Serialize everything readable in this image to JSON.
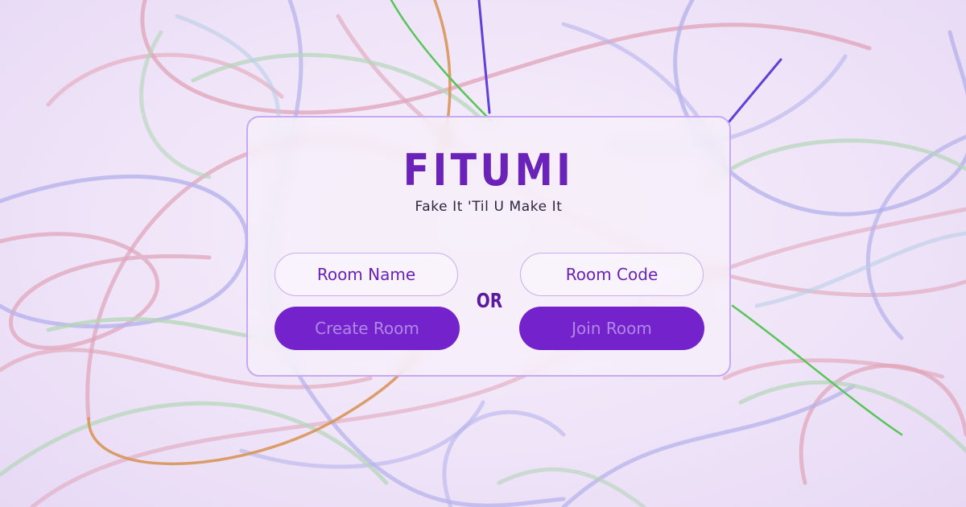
{
  "app": {
    "title": "FITUMI",
    "subtitle": "Fake It 'Til U Make It"
  },
  "create": {
    "room_name_placeholder": "Room Name",
    "button_label": "Create Room"
  },
  "join": {
    "room_code_placeholder": "Room Code",
    "button_label": "Join Room"
  },
  "separator": "OR",
  "colors": {
    "accent": "#7423cc",
    "title": "#6a22b8",
    "button_text": "#b088e6",
    "border": "#c6a9f1"
  }
}
